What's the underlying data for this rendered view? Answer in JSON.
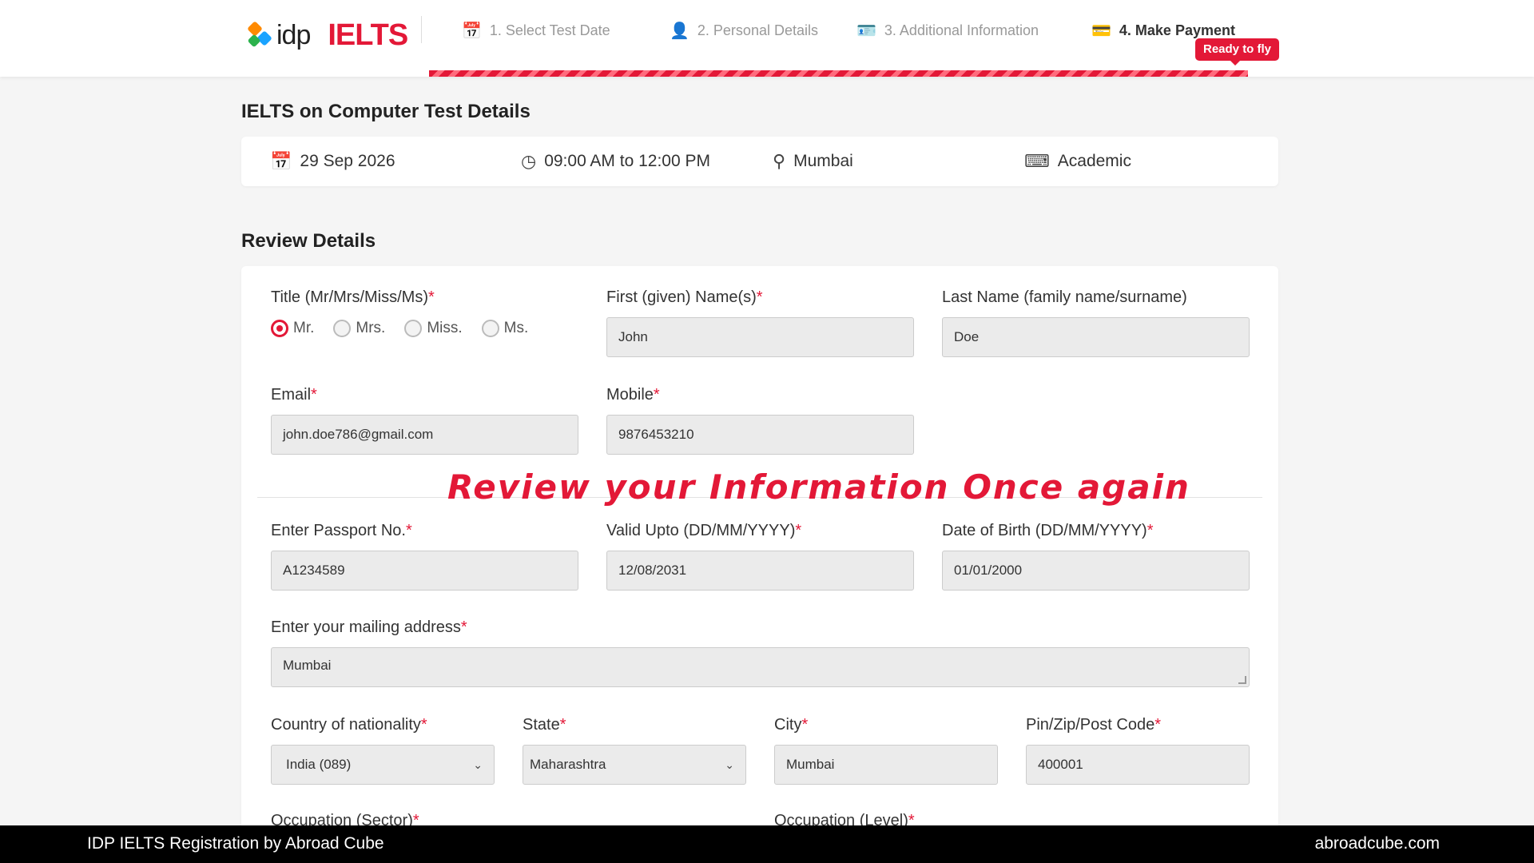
{
  "header": {
    "brand_idp": "idp",
    "brand_ielts": "IELTS",
    "steps": [
      {
        "label": "1. Select Test Date",
        "icon": "calendar-icon"
      },
      {
        "label": "2. Personal Details",
        "icon": "user-icon"
      },
      {
        "label": "3. Additional Information",
        "icon": "id-card-icon"
      },
      {
        "label": "4. Make Payment",
        "icon": "credit-card-icon"
      }
    ],
    "badge": "Ready to fly",
    "accent_color": "#e31837"
  },
  "test_details": {
    "title": "IELTS on Computer Test Details",
    "date": "29 Sep 2026",
    "time": "09:00 AM to 12:00 PM",
    "location": "Mumbai",
    "module": "Academic"
  },
  "review": {
    "title": "Review Details",
    "title_label": "Title (Mr/Mrs/Miss/Ms)",
    "title_options": [
      "Mr.",
      "Mrs.",
      "Miss.",
      "Ms."
    ],
    "title_selected": "Mr.",
    "first_name_label": "First (given) Name(s)",
    "first_name": "John",
    "last_name_label": "Last Name (family name/surname)",
    "last_name": "Doe",
    "email_label": "Email",
    "email": "john.doe786@gmail.com",
    "mobile_label": "Mobile",
    "mobile": "9876453210",
    "passport_label": "Enter Passport No.",
    "passport": "A1234589",
    "valid_label": "Valid Upto (DD/MM/YYYY)",
    "valid": "12/08/2031",
    "dob_label": "Date of Birth (DD/MM/YYYY)",
    "dob": "01/01/2000",
    "address_label": "Enter your mailing address",
    "address": "Mumbai",
    "country_label": "Country of nationality",
    "country": "India (089)",
    "state_label": "State",
    "state": "Maharashtra",
    "city_label": "City",
    "city": "Mumbai",
    "pin_label": "Pin/Zip/Post Code",
    "pin": "400001",
    "occupation_sector_label": "Occupation (Sector)",
    "occupation_level_label": "Occupation (Level)",
    "required_mark": "*"
  },
  "overlay_caption": "Review your Information Once again",
  "footer": {
    "left": "IDP IELTS Registration by Abroad Cube",
    "right": "abroadcube.com"
  }
}
